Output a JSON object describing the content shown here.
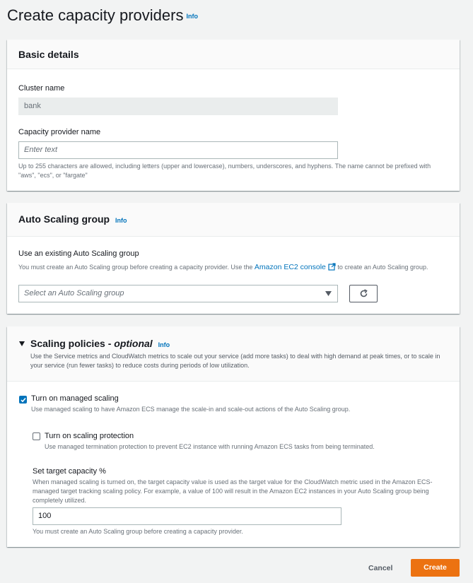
{
  "page": {
    "title": "Create capacity providers",
    "info": "Info"
  },
  "basic": {
    "title": "Basic details",
    "cluster_label": "Cluster name",
    "cluster_value": "bank",
    "provider_label": "Capacity provider name",
    "provider_placeholder": "Enter text",
    "provider_desc": "Up to 255 characters are allowed, including letters (upper and lowercase), numbers, underscores, and hyphens. The name cannot be prefixed with \"aws\", \"ecs\", or \"fargate\""
  },
  "asg": {
    "title": "Auto Scaling group",
    "info": "Info",
    "use_label": "Use an existing Auto Scaling group",
    "desc_pre": "You must create an Auto Scaling group before creating a capacity provider. Use the",
    "link": "Amazon EC2 console",
    "desc_post": "to create an Auto Scaling group.",
    "select_placeholder": "Select an Auto Scaling group"
  },
  "scaling": {
    "title": "Scaling policies - ",
    "title_optional": "optional",
    "info": "Info",
    "desc": "Use the Service metrics and CloudWatch metrics to scale out your service (add more tasks) to deal with high demand at peak times, or to scale in your service (run fewer tasks) to reduce costs during periods of low utilization.",
    "managed_label": "Turn on managed scaling",
    "managed_checked": true,
    "managed_desc": "Use managed scaling to have Amazon ECS manage the scale-in and scale-out actions of the Auto Scaling group.",
    "protection_label": "Turn on scaling protection",
    "protection_checked": false,
    "protection_desc": "Use managed termination protection to prevent EC2 instance with running Amazon ECS tasks from being terminated.",
    "target_label": "Set target capacity %",
    "target_desc": "When managed scaling is turned on, the target capacity value is used as the target value for the CloudWatch metric used in the Amazon ECS-managed target tracking scaling policy. For example, a value of 100 will result in the Amazon EC2 instances in your Auto Scaling group being completely utilized.",
    "target_value": "100",
    "target_help": "You must create an Auto Scaling group before creating a capacity provider."
  },
  "actions": {
    "cancel": "Cancel",
    "create": "Create"
  },
  "colors": {
    "primary": "#ec7211",
    "link": "#0073bb",
    "checkbox": "#0073bb"
  },
  "icons": [
    "external-link-icon",
    "caret-down-icon",
    "refresh-icon",
    "caret-expanded-icon",
    "check-icon"
  ]
}
